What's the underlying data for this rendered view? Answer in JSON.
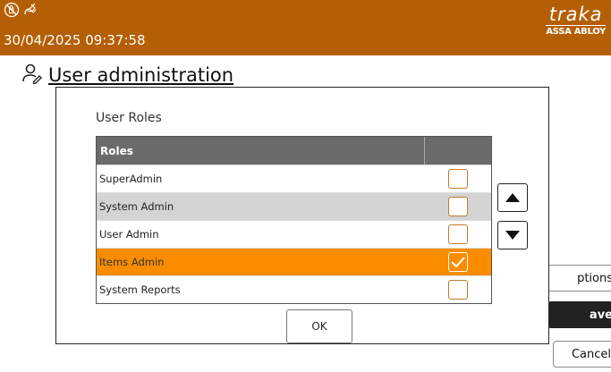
{
  "header": {
    "datetime": "30/04/2025 09:37:58",
    "brand": "traka",
    "brand_sub": "ASSA ABLOY",
    "icons": [
      "no-touch-icon",
      "power-plug-icon"
    ]
  },
  "page": {
    "title": "User administration",
    "title_icon": "user-edit-icon"
  },
  "side_buttons": {
    "options": "ptions",
    "save": "ave",
    "cancel": "Cancel"
  },
  "modal": {
    "title": "User Roles",
    "table": {
      "header_roles": "Roles",
      "rows": [
        {
          "role": "SuperAdmin",
          "checked": false,
          "state": "normal"
        },
        {
          "role": "System Admin",
          "checked": false,
          "state": "shaded"
        },
        {
          "role": "User Admin",
          "checked": false,
          "state": "normal"
        },
        {
          "role": "Items Admin",
          "checked": true,
          "state": "selected"
        },
        {
          "role": "System Reports",
          "checked": false,
          "state": "normal"
        }
      ]
    },
    "ok_label": "OK"
  },
  "colors": {
    "header_bg": "#b45f06",
    "selected_row": "#fb8c00",
    "shaded_row": "#d3d3d3",
    "table_header": "#6b6b6b"
  }
}
